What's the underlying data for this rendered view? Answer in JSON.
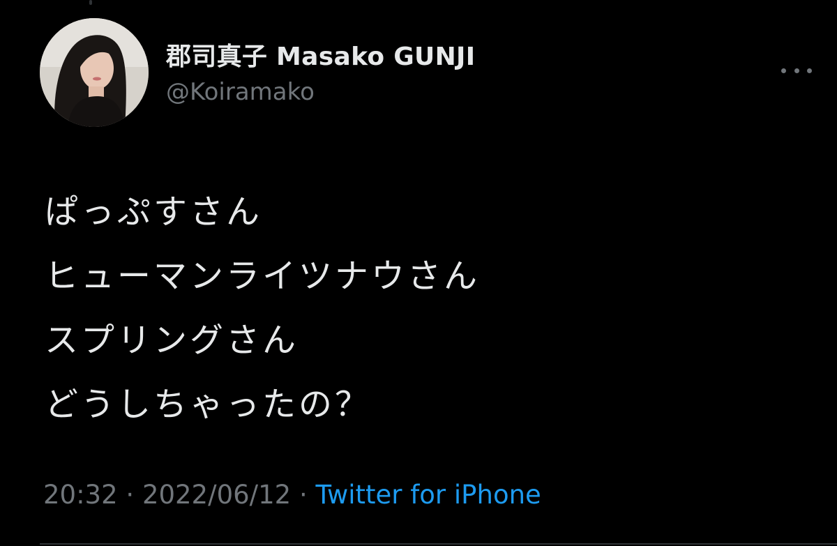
{
  "tweet": {
    "author_name": "郡司真子 Masako GUNJI",
    "author_handle": "@Koiramako",
    "lines": [
      "ぱっぷすさん",
      "ヒューマンライツナウさん",
      "スプリングさん",
      "どうしちゃったの？"
    ],
    "time": "20:32",
    "separator": "·",
    "date": "2022/06/12",
    "source": "Twitter for iPhone"
  },
  "icons": {
    "more": "more-horizontal-icon"
  },
  "colors": {
    "background": "#000000",
    "primary_text": "#e7e9ea",
    "secondary_text": "#71767b",
    "link": "#1d9bf0"
  }
}
